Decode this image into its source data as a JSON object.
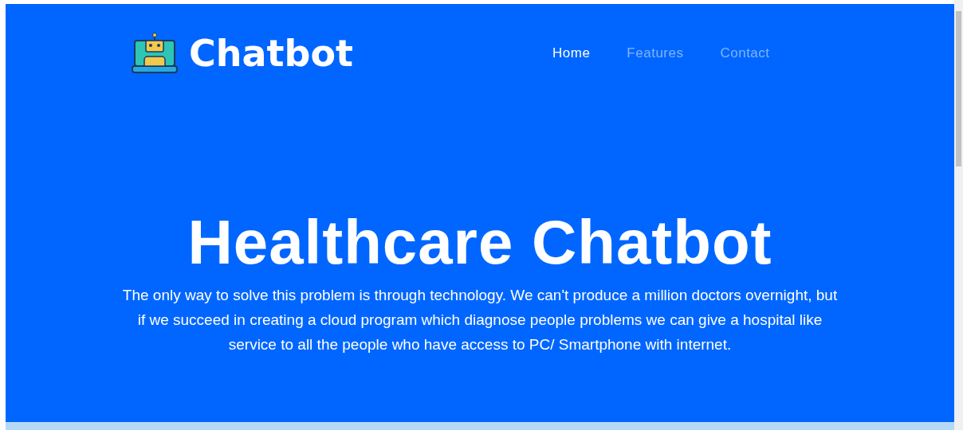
{
  "brand": {
    "name": "Chatbot"
  },
  "nav": [
    {
      "label": "Home",
      "selected": true
    },
    {
      "label": "Features",
      "selected": false
    },
    {
      "label": "Contact",
      "selected": false
    }
  ],
  "hero": {
    "title": "Healthcare Chatbot",
    "text": "The only way to solve this problem is through technology. We can't produce a million doctors overnight, but if we succeed in creating a cloud program which diagnose people problems we can give a hospital like service to all the people who have access to PC/ Smartphone with internet."
  }
}
